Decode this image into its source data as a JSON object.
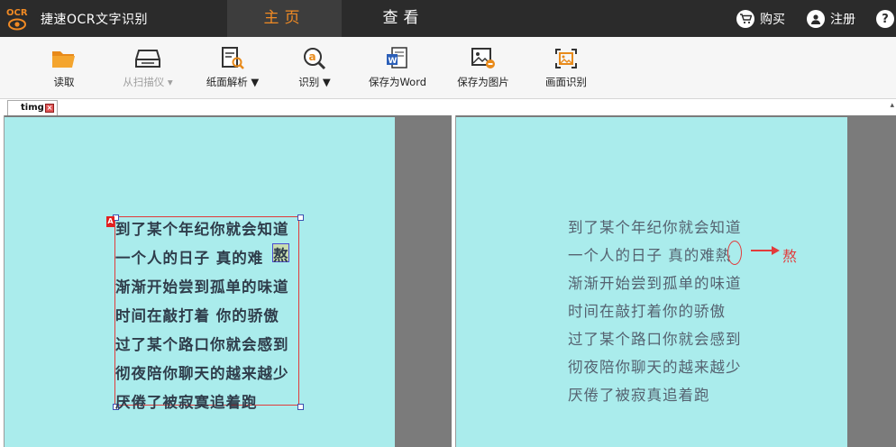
{
  "app": {
    "logo_text": "OCR",
    "title": "捷速OCR文字识别"
  },
  "nav": {
    "tabs": [
      {
        "label": "主页",
        "active": true
      },
      {
        "label": "查看",
        "active": false
      }
    ]
  },
  "topbar": {
    "buy_label": "购买",
    "register_label": "注册",
    "help_label": "?"
  },
  "toolbar": {
    "items": [
      {
        "label": "读取",
        "icon": "folder-open-icon",
        "enabled": true
      },
      {
        "label": "从扫描仪 ▾",
        "icon": "scanner-icon",
        "enabled": false
      },
      {
        "label": "纸面解析 ▼",
        "icon": "page-analyze-icon",
        "enabled": true
      },
      {
        "label": "识别 ▼",
        "icon": "recognize-icon",
        "enabled": true
      },
      {
        "label": "保存为Word",
        "icon": "word-doc-icon",
        "enabled": true
      },
      {
        "label": "保存为图片",
        "icon": "save-image-icon",
        "enabled": true
      },
      {
        "label": "画面识别",
        "icon": "screen-capture-icon",
        "enabled": true
      }
    ]
  },
  "document_tab": {
    "label": "timg",
    "close_glyph": "×"
  },
  "left_panel": {
    "region_marker": "A",
    "lines": [
      "到了某个年纪你就会知道",
      "一个人的日子 真的难",
      "渐渐开始尝到孤单的味道",
      "时间在敲打着 你的骄傲",
      "过了某个路口你就会感到",
      "彻夜陪你聊天的越来越少",
      "厌倦了被寂寞追着跑"
    ],
    "highlighted_char": "熬"
  },
  "right_panel": {
    "lines": [
      "到了某个年纪你就会知道",
      "一个人的日子 真的难熱",
      "渐渐开始尝到孤单的味道",
      "时间在敲打着你的骄傲",
      "过了某个路口你就会感到",
      "彻夜陪你聊天的越来越少",
      "厌倦了被寂真追着跑"
    ],
    "correction_char": "熬"
  },
  "colors": {
    "accent": "#f08a24",
    "titlebar": "#2b2b2b",
    "page_bg": "#aaecec",
    "selection": "#e03a3a"
  }
}
